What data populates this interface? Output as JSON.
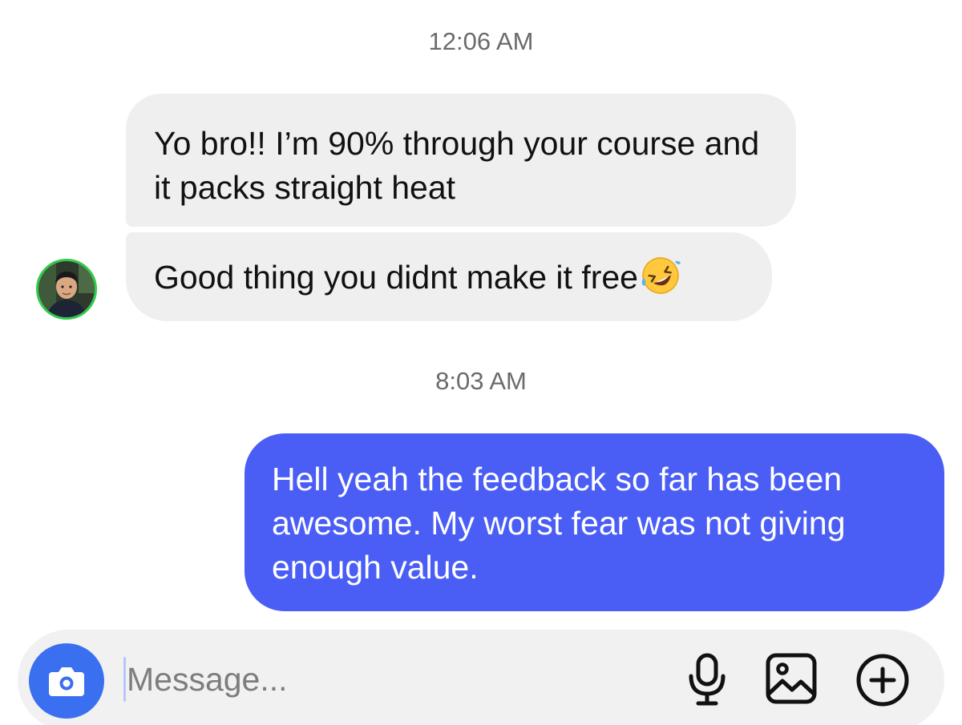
{
  "thread": {
    "timestamps": [
      "12:06 AM",
      "8:03 AM"
    ],
    "messages": [
      {
        "from": "them",
        "text": "Yo bro!! I’m 90% through your course and it packs straight heat"
      },
      {
        "from": "them",
        "text": "Good thing you didnt make it free",
        "emoji": "rolling-on-floor-laughing-emoji"
      },
      {
        "from": "me",
        "text": "Hell yeah the feedback so far has been awesome. My worst fear was not giving enough value."
      }
    ]
  },
  "composer": {
    "placeholder": "Message...",
    "value": "",
    "icons": [
      "camera-icon",
      "microphone-icon",
      "gallery-icon",
      "add-icon"
    ]
  },
  "colors": {
    "outgoing_bubble": "#4a5ef6",
    "incoming_bubble": "#efefef",
    "camera_button": "#3a6ff0",
    "avatar_ring": "#2fcb4a"
  }
}
